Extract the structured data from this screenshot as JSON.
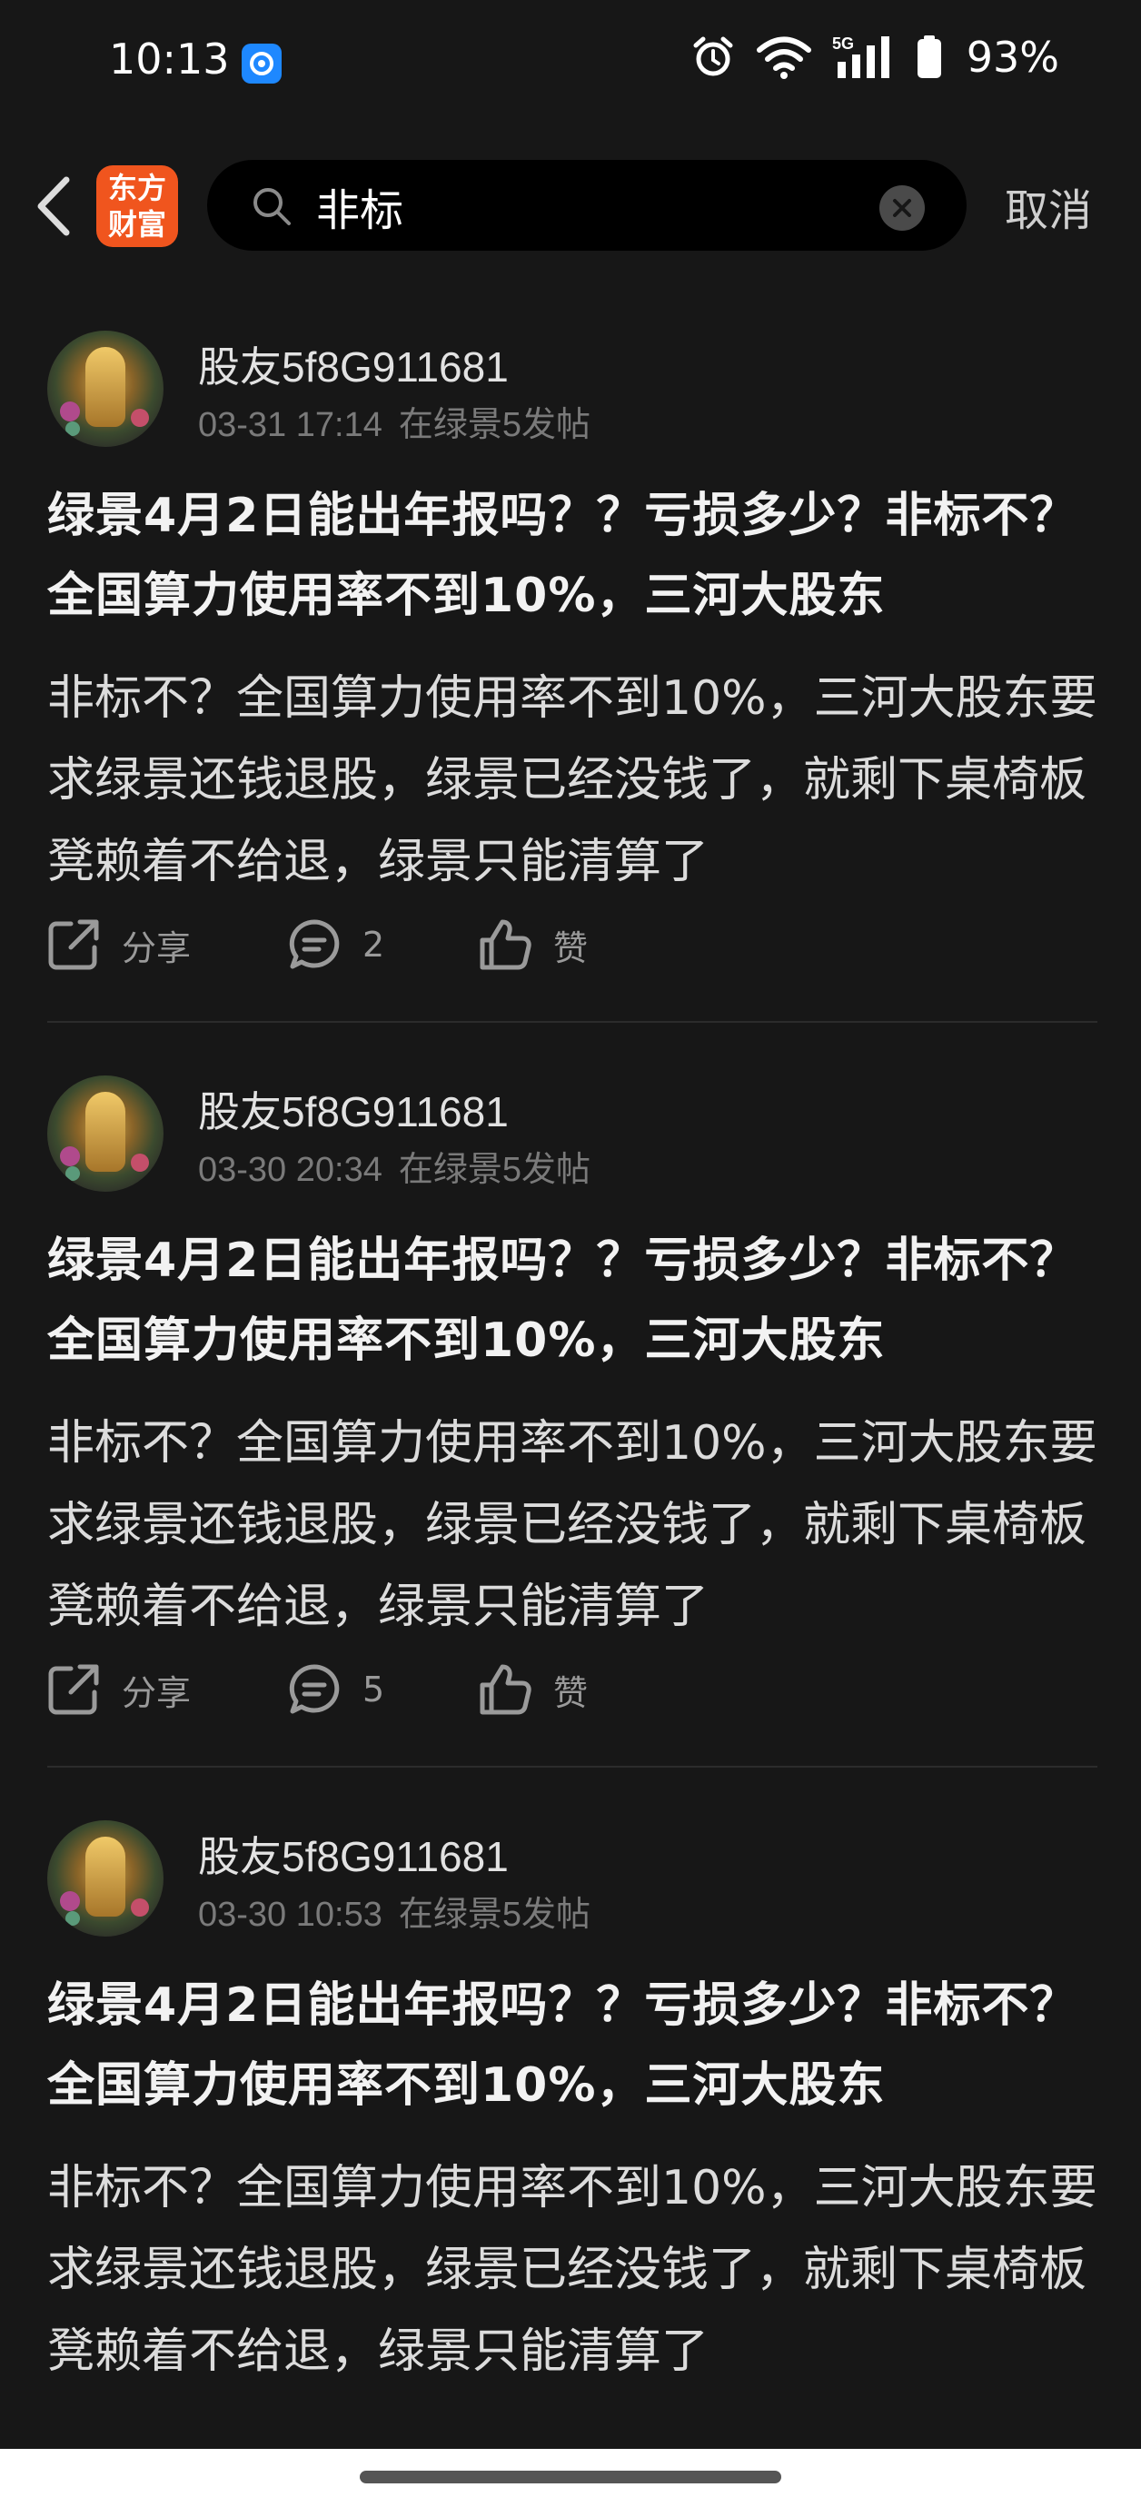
{
  "status_bar": {
    "time": "10:13",
    "network": "5G",
    "battery": "93%",
    "icons": [
      "app-notification-icon",
      "alarm-icon",
      "wifi-icon",
      "signal-icon",
      "battery-icon"
    ]
  },
  "header": {
    "brand_line1": "东方",
    "brand_line2": "财富",
    "search_value": "非标",
    "cancel_label": "取消"
  },
  "colors": {
    "background": "#171717",
    "brand": "#f0551e",
    "text_primary": "#f2f2f2",
    "text_secondary": "#7a7a7a"
  },
  "posts": [
    {
      "user": "股友5f8G911681",
      "time": "03-31 17:14",
      "place": "在绿景5发帖",
      "title": "绿景4月2日能出年报吗？？亏损多少？非标不？全国算力使用率不到10%，三河大股东",
      "body": "非标不？全国算力使用率不到10%，三河大股东要求绿景还钱退股，绿景已经没钱了，就剩下桌椅板凳赖着不给退，绿景只能清算了",
      "share_label": "分享",
      "comment_count": "2",
      "like_label": "赞"
    },
    {
      "user": "股友5f8G911681",
      "time": "03-30 20:34",
      "place": "在绿景5发帖",
      "title": "绿景4月2日能出年报吗？？亏损多少？非标不？全国算力使用率不到10%，三河大股东",
      "body": "非标不？全国算力使用率不到10%，三河大股东要求绿景还钱退股，绿景已经没钱了，就剩下桌椅板凳赖着不给退，绿景只能清算了",
      "share_label": "分享",
      "comment_count": "5",
      "like_label": "赞"
    },
    {
      "user": "股友5f8G911681",
      "time": "03-30 10:53",
      "place": "在绿景5发帖",
      "title": "绿景4月2日能出年报吗？？亏损多少？非标不？全国算力使用率不到10%，三河大股东",
      "body": "非标不？全国算力使用率不到10%，三河大股东要求绿景还钱退股，绿景已经没钱了，就剩下桌椅板凳赖着不给退，绿景只能清算了"
    }
  ]
}
